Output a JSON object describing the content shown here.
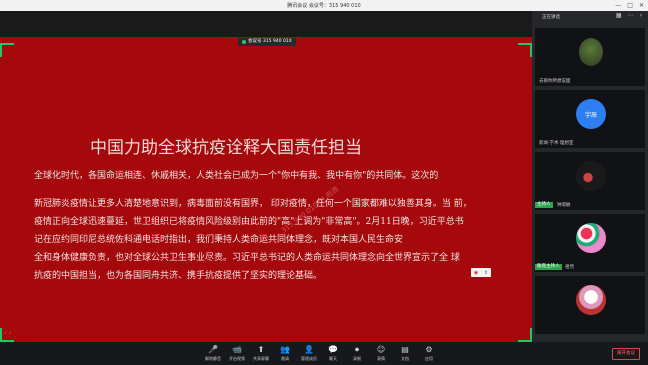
{
  "window": {
    "title": "腾讯会议 会议号：315 940 010",
    "controls": [
      "—",
      "□",
      "✕"
    ]
  },
  "share": {
    "badge": "会议号 315 940 010",
    "title": "中国力助全球抗疫诠释大国责任担当",
    "paragraphs": [
      "全球化时代，各国命运相连、休戚相关，人类社会已成为一个\"你中有我、我中有你\"的共同体。这次的",
      "新冠肺炎疫情让更多人清楚地意识到，病毒面前没有国界，  印对疫情，任何一个国家都难以独善其身。当 前，",
      "疫情正向全球迅速蔓延，世卫组织已将疫情风险级别由此前的\"高\"上调为\"非常高\"。2月11日晚，习近平总书",
      "记在应约同印尼总统佐科通电话时指出，我们秉持人类命运共同体理念，既对本国人民生命安",
      "全和身体健康负责，也对全球公共卫生事业尽责。习近平总书记的人类命运共同体理念向全世界宣示了全 球",
      "抗疫的中国担当，也为各国同舟共济、携手抗疫提供了坚实的理论基础。"
    ],
    "watermark": "315 940 010 ||| 雨洒",
    "corner_note": "✓ ✓"
  },
  "side": {
    "title": "正在讲话",
    "icons": [
      "grid-icon",
      "more-icon",
      "collapse-icon"
    ],
    "tiles": [
      {
        "name": "去那你所想说面",
        "tag": ""
      },
      {
        "name": "新闻·学术·理想室",
        "tag": "",
        "avatar_text": "宇辰"
      },
      {
        "name": "钟淑敏",
        "tag": "主持人"
      },
      {
        "name": "祖然",
        "tag": "联席主持人"
      },
      {
        "name": "",
        "tag": ""
      }
    ]
  },
  "toolbar": {
    "items": [
      {
        "icon": "🎤",
        "label": "解除静音"
      },
      {
        "icon": "📹",
        "label": "开启视频"
      },
      {
        "icon": "⬆",
        "label": "共享屏幕"
      },
      {
        "icon": "👥",
        "label": "邀请"
      },
      {
        "icon": "👤",
        "label": "管理成员"
      },
      {
        "icon": "💬",
        "label": "聊天"
      },
      {
        "icon": "⏺",
        "label": "录制"
      },
      {
        "icon": "☺",
        "label": "表情"
      },
      {
        "icon": "▤",
        "label": "文档"
      },
      {
        "icon": "⚙",
        "label": "应用"
      }
    ],
    "leave": "离开会议"
  },
  "colors": {
    "share_background": "#a5090c",
    "focus_corner": "#24c46a",
    "leave_red": "#e04848"
  }
}
